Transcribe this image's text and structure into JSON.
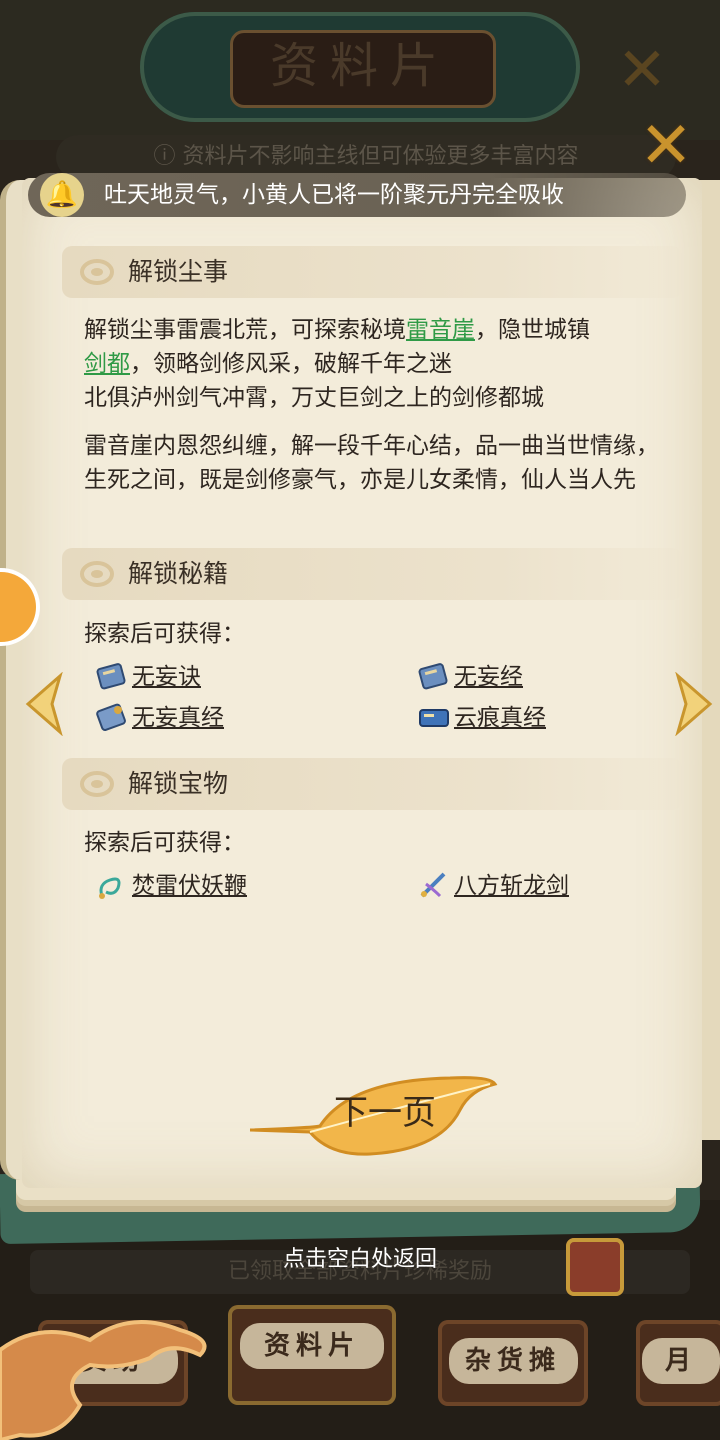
{
  "background": {
    "title": "资料片",
    "notice": "资料片不影响主线但可体验更多丰富内容",
    "reward_bar": "已领取全部资料片珍稀奖励",
    "tabs": [
      "资助",
      "资料片",
      "杂货摊",
      "月"
    ]
  },
  "hint": {
    "text": "吐天地灵气，小黄人已将一阶聚元丹完全吸收",
    "icon": "bell-icon"
  },
  "sections": {
    "dust": {
      "title": "解锁尘事",
      "line1_a": "解锁尘事雷震北荒，可探索秘境",
      "line1_link": "雷音崖",
      "line1_b": "，隐世城镇",
      "line2_link": "剑都",
      "line2_b": "，领略剑修风采，破解千年之迷",
      "line3": "北俱泸州剑气冲霄，万丈巨剑之上的剑修都城",
      "para2": "雷音崖内恩怨纠缠，解一段千年心结，品一曲当世情缘，生死之间，既是剑修豪气，亦是儿女柔情，仙人当人先"
    },
    "books": {
      "title": "解锁秘籍",
      "subtitle": "探索后可获得：",
      "items": [
        "无妄诀",
        "无妄经",
        "无妄真经",
        "云痕真经"
      ]
    },
    "treasures": {
      "title": "解锁宝物",
      "subtitle": "探索后可获得：",
      "items": [
        "焚雷伏妖鞭",
        "八方斩龙剑"
      ]
    }
  },
  "next_button": "下一页",
  "return_hint": "点击空白处返回",
  "colors": {
    "link": "#2f9a46",
    "accent": "#c9932d",
    "page": "#f3ecda"
  }
}
